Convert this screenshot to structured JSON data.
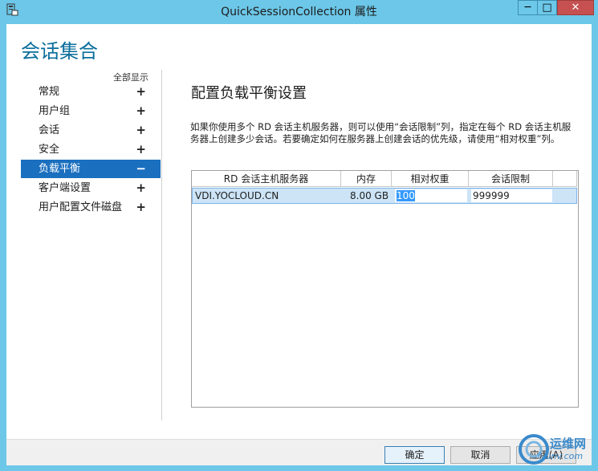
{
  "window": {
    "title": "QuickSessionCollection 属性"
  },
  "header": {
    "title": "会话集合"
  },
  "nav": {
    "show_all": "全部显示",
    "items": [
      {
        "label": "常规",
        "sign": "+"
      },
      {
        "label": "用户组",
        "sign": "+"
      },
      {
        "label": "会话",
        "sign": "+"
      },
      {
        "label": "安全",
        "sign": "+"
      },
      {
        "label": "负载平衡",
        "sign": "−",
        "active": true
      },
      {
        "label": "客户端设置",
        "sign": "+"
      },
      {
        "label": "用户配置文件磁盘",
        "sign": "+"
      }
    ]
  },
  "panel": {
    "title": "配置负载平衡设置",
    "description": "如果你使用多个 RD 会话主机服务器，则可以使用“会话限制”列，指定在每个 RD 会话主机服务器上创建多少会话。若要确定如何在服务器上创建会话的优先级，请使用“相对权重”列。"
  },
  "table": {
    "columns": [
      "RD 会话主机服务器",
      "内存",
      "相对权重",
      "会话限制"
    ],
    "rows": [
      {
        "server": "VDI.YOCLOUD.CN",
        "memory": "8.00 GB",
        "weight": "100",
        "limit": "999999"
      }
    ]
  },
  "footer": {
    "ok": "确定",
    "cancel": "取消",
    "apply": "应用(A)"
  },
  "watermark": {
    "text": "运维网",
    "url": "iyunv.com"
  },
  "colors": {
    "titlebar": "#6cc7e8",
    "accent": "#0a6e9c",
    "active_nav": "#1b6fbf",
    "close": "#c75050"
  }
}
